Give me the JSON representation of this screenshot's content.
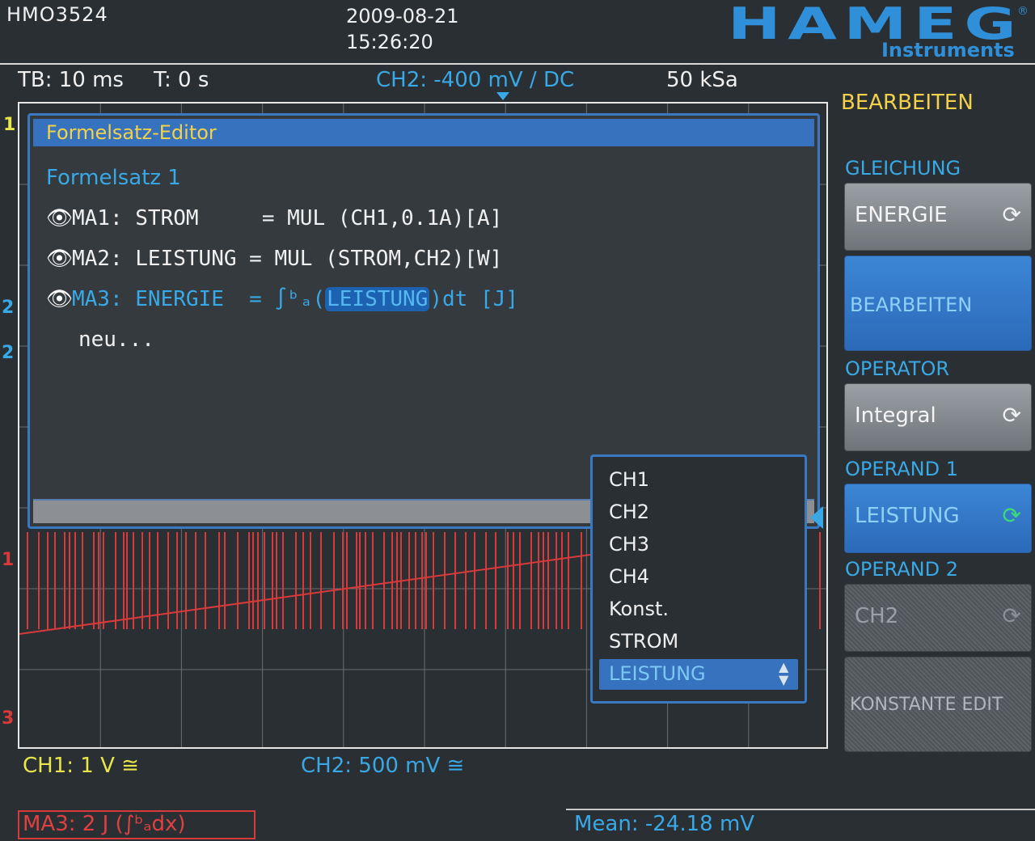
{
  "header": {
    "model": "HMO3524",
    "date": "2009-08-21",
    "time": "15:26:20",
    "logo_main": "HAMEG",
    "logo_reg": "®",
    "logo_sub": "Instruments"
  },
  "status": {
    "timebase": "TB: 10 ms",
    "trigger": "T: 0 s",
    "ch2": "CH2: -400 mV / DC",
    "sample_rate": "50 kSa"
  },
  "markers": {
    "trigger": "1",
    "ch2_a": "2",
    "ch2_b": "2",
    "ch1": "1",
    "math": "3"
  },
  "editor": {
    "title": "Formelsatz-Editor",
    "set_name": "Formelsatz 1",
    "rows": [
      {
        "id": "MA1:",
        "name": "STROM    ",
        "eq": " = ",
        "expr": "MUL (CH1,0.1A)[A]"
      },
      {
        "id": "MA2:",
        "name": "LEISTUNG",
        "eq": " = ",
        "expr": "MUL (STROM,CH2)[W]"
      },
      {
        "id": "MA3:",
        "name": "ENERGIE ",
        "eq": " = ",
        "prefix": "∫ᵇₐ(",
        "operand": "LEISTUNG",
        "suffix": ")dt [J]"
      }
    ],
    "new_entry": "neu..."
  },
  "dropdown": {
    "items": [
      "CH1",
      "CH2",
      "CH3",
      "CH4",
      "Konst.",
      "STROM"
    ],
    "selected": "LEISTUNG",
    "selected_arrow": "▲▼"
  },
  "menu": {
    "title": "BEARBEITEN",
    "gleichung_label": "GLEICHUNG",
    "gleichung_value": "ENERGIE",
    "edit_button": "BEARBEITEN",
    "operator_label": "OPERATOR",
    "operator_value": "Integral",
    "operand1_label": "OPERAND 1",
    "operand1_value": "LEISTUNG",
    "operand2_label": "OPERAND 2",
    "operand2_value": "CH2",
    "const_button": "KONSTANTE EDIT",
    "rotary_icon": "⟳"
  },
  "footer": {
    "ch1": "CH1: 1 V ≅",
    "ch2": "CH2: 500 mV ≅",
    "math": "MA3: 2 J (∫ᵇₐdx)",
    "measurement": "Mean: -24.18 mV"
  },
  "colors": {
    "ch1": "#e8e64a",
    "ch2": "#39a8e6",
    "math": "#e04040",
    "accent": "#3672bd"
  }
}
